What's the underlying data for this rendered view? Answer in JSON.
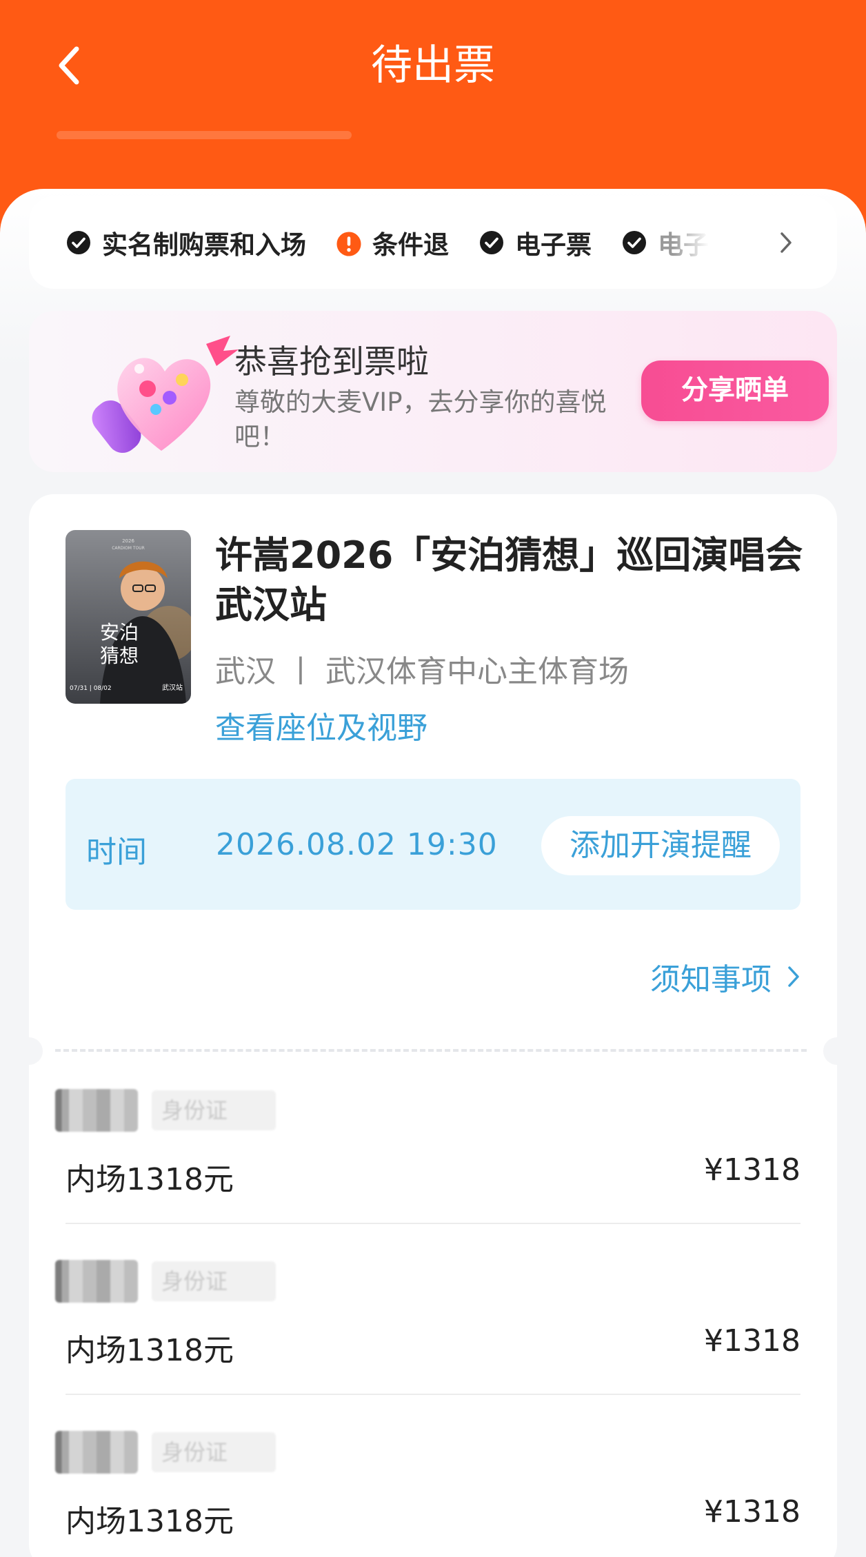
{
  "header": {
    "title": "待出票",
    "back_icon": "chevron-left-icon",
    "background_color": "#ff5a14"
  },
  "features": [
    {
      "label": "实名制购票和入场",
      "icon": "check-circle-icon"
    },
    {
      "label": "条件退",
      "icon": "warning-circle-icon",
      "icon_color": "#ff5a14"
    },
    {
      "label": "电子票",
      "icon": "check-circle-icon"
    },
    {
      "label": "电子",
      "icon": "check-circle-icon"
    }
  ],
  "promo": {
    "title": "恭喜抢到票啦",
    "description": "尊敬的大麦VIP，去分享你的喜悦吧！",
    "button_label": "分享晒单"
  },
  "event": {
    "title": "许嵩2026「安泊猜想」巡回演唱会 武汉站",
    "venue": "武汉 丨 武汉体育中心主体育场",
    "seat_link": "查看座位及视野",
    "poster_text": "安泊猜想",
    "time_label": "时间",
    "time_value": "2026.08.02 19:30",
    "remind_button": "添加开演提醒",
    "notice_link": "须知事项"
  },
  "tickets": [
    {
      "holder_id_type": "身份证",
      "name": "内场1318元",
      "price": "¥1318"
    },
    {
      "holder_id_type": "身份证",
      "name": "内场1318元",
      "price": "¥1318"
    },
    {
      "holder_id_type": "身份证",
      "name": "内场1318元",
      "price": "¥1318"
    }
  ],
  "colors": {
    "accent": "#ff5a14",
    "link": "#3aa0d8",
    "share_button": "#f74d93"
  }
}
